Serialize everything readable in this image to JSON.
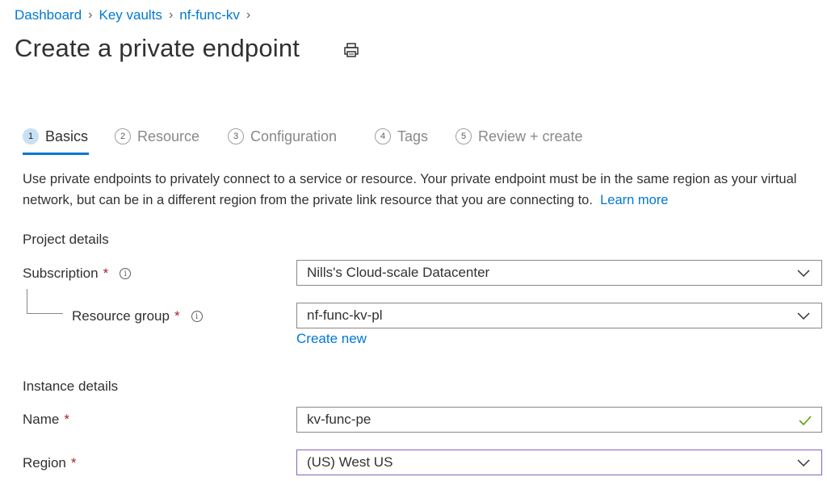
{
  "breadcrumb": [
    {
      "label": "Dashboard"
    },
    {
      "label": "Key vaults"
    },
    {
      "label": "nf-func-kv"
    }
  ],
  "page": {
    "title": "Create a private endpoint",
    "print_icon": "print-icon"
  },
  "tabs": [
    {
      "num": "1",
      "label": "Basics",
      "active": true
    },
    {
      "num": "2",
      "label": "Resource",
      "active": false
    },
    {
      "num": "3",
      "label": "Configuration",
      "active": false
    },
    {
      "num": "4",
      "label": "Tags",
      "active": false
    },
    {
      "num": "5",
      "label": "Review + create",
      "active": false
    }
  ],
  "description": {
    "text": "Use private endpoints to privately connect to a service or resource. Your private endpoint must be in the same region as your virtual network, but can be in a different region from the private link resource that you are connecting to.",
    "link": "Learn more"
  },
  "project": {
    "heading": "Project details",
    "subscription": {
      "label": "Subscription",
      "value": "Nills's Cloud-scale Datacenter"
    },
    "resource_group": {
      "label": "Resource group",
      "value": "nf-func-kv-pl",
      "create_new": "Create new"
    }
  },
  "instance": {
    "heading": "Instance details",
    "name": {
      "label": "Name",
      "value": "kv-func-pe"
    },
    "region": {
      "label": "Region",
      "value": "(US) West US"
    }
  },
  "common": {
    "required_mark": "*",
    "info_glyph": "i"
  },
  "colors": {
    "accent": "#0078d4",
    "required": "#a4262c",
    "valid": "#57a300",
    "focus_border": "#8764b8"
  }
}
